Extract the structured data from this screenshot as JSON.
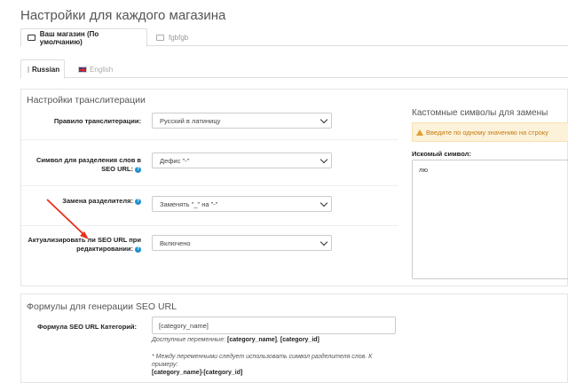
{
  "page_title": "Настройки для каждого магазина",
  "store_tabs": [
    {
      "label": "Ваш магазин (По умолчанию)",
      "icon": "folder-open-icon"
    },
    {
      "label": "fgbfgb",
      "icon": "folder-icon"
    }
  ],
  "lang_tabs": [
    {
      "label": "Russian",
      "icon": "flag-ru-icon"
    },
    {
      "label": "English",
      "icon": "flag-en-icon"
    }
  ],
  "translit": {
    "heading": "Настройки транслитерации",
    "rule": {
      "label": "Правило транслитерации:",
      "value": "Русский в латиницу"
    },
    "separator": {
      "label_line1": "Символ для разделения слов в",
      "label_line2": "SEO URL:",
      "value": "Дефис \"-\""
    },
    "replace": {
      "label": "Замена разделителя:",
      "value": "Заменять \"_\" на \"-\""
    },
    "update": {
      "label_line1": "Актуализировать ли SEO URL при",
      "label_line2": "редактировании:",
      "value": "Включено"
    }
  },
  "custom_symbols": {
    "title": "Кастомные символы для замены",
    "alert": "Введите по одному значению на строку",
    "search_label": "Искомый символ:",
    "search_value": "лю"
  },
  "formulas": {
    "heading": "Формулы для генерации SEO URL",
    "category_label": "Формула SEO URL Категорий:",
    "category_value": "[category_name]",
    "vars_prefix": "Доступные переменные:",
    "var1": "[category_name]",
    "vars_sep": ",",
    "var2": "[category_id]",
    "note_line1": "* Между переменными следует использовать символ разделителя слов. К",
    "note_line2": "примеру:",
    "example": "[category_name]-[category_id]"
  },
  "colors": {
    "accent": "#1e91cf",
    "alert_bg": "#fcf1d9",
    "alert_text": "#c47c12",
    "annotation_arrow": "#e8301c"
  }
}
